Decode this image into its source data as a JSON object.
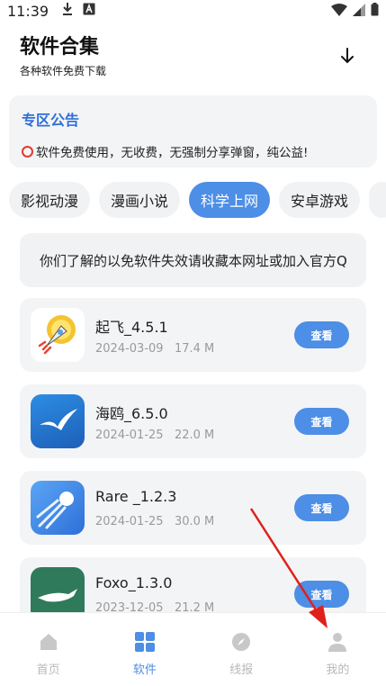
{
  "status_bar": {
    "time": "11:39",
    "icons": [
      "download-icon",
      "a-badge-icon",
      "wifi-icon",
      "signal-icon",
      "battery-icon"
    ]
  },
  "header": {
    "title": "软件合集",
    "subtitle": "各种软件免费下载",
    "download_icon": "arrow-down-icon"
  },
  "notice": {
    "title": "专区公告",
    "text": "软件免费使用，无收费，无强制分享弹窗，纯公益!",
    "icon": "red-ring-icon"
  },
  "tabs": [
    {
      "label": "影视动漫",
      "active": false
    },
    {
      "label": "漫画小说",
      "active": false
    },
    {
      "label": "科学上网",
      "active": true
    },
    {
      "label": "安卓游戏",
      "active": false
    }
  ],
  "marquee": {
    "text": "你们了解的以免软件失效请收藏本网址或加入官方Q"
  },
  "apps": [
    {
      "name": "起飞_4.5.1",
      "date": "2024-03-09",
      "size": "17.4 M",
      "button": "查看",
      "icon": "rocket-icon"
    },
    {
      "name": "海鸥_6.5.0",
      "date": "2024-01-25",
      "size": "22.0 M",
      "button": "查看",
      "icon": "seagull-icon"
    },
    {
      "name": "Rare _1.2.3",
      "date": "2024-01-25",
      "size": "30.0 M",
      "button": "查看",
      "icon": "comet-icon"
    },
    {
      "name": "Foxo_1.3.0",
      "date": "2023-12-05",
      "size": "21.2 M",
      "button": "查看",
      "icon": "fox-icon"
    }
  ],
  "bottom_nav": [
    {
      "label": "首页",
      "icon": "home-icon",
      "active": false
    },
    {
      "label": "软件",
      "icon": "grid-icon",
      "active": true
    },
    {
      "label": "线报",
      "icon": "compass-icon",
      "active": false
    },
    {
      "label": "我的",
      "icon": "user-icon",
      "active": false
    }
  ],
  "colors": {
    "accent": "#4d8ee6",
    "notice_title": "#2f6fd8",
    "card_bg": "#f3f4f6",
    "annotation_arrow": "#e0201a"
  }
}
